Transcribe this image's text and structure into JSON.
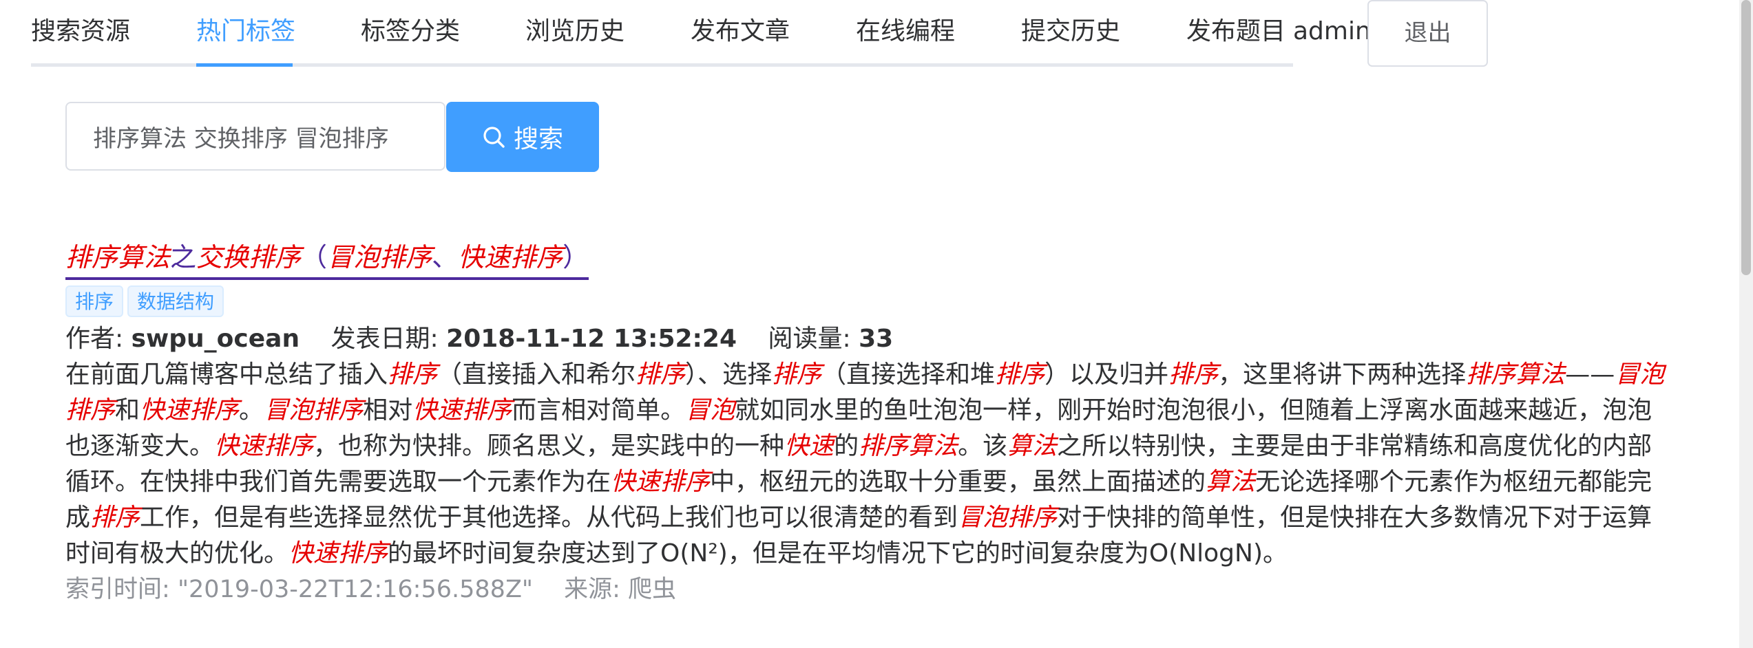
{
  "nav": {
    "tabs": [
      "搜索资源",
      "热门标签",
      "标签分类",
      "浏览历史",
      "发布文章",
      "在线编程",
      "提交历史",
      "发布题目"
    ],
    "active_tab": "热门标签",
    "user": "admin",
    "logout_label": "退出"
  },
  "search": {
    "value": "排序算法 交换排序 冒泡排序",
    "button_label": "搜索",
    "button_icon": "search-icon"
  },
  "result": {
    "title_segments": [
      {
        "text": "排序算法",
        "highlight": true
      },
      {
        "text": "之",
        "highlight": false
      },
      {
        "text": "交换排序",
        "highlight": true
      },
      {
        "text": "（",
        "highlight": false
      },
      {
        "text": "冒泡排序",
        "highlight": true
      },
      {
        "text": "、",
        "highlight": false
      },
      {
        "text": "快速排序",
        "highlight": true
      },
      {
        "text": "）",
        "highlight": false
      }
    ],
    "tags": [
      "排序",
      "数据结构"
    ],
    "author_label": "作者:",
    "author": "swpu_ocean",
    "date_label": "发表日期:",
    "date": "2018-11-12 13:52:24",
    "reads_label": "阅读量:",
    "reads": "33",
    "summary_segments": [
      {
        "text": "在前面几篇博客中总结了插入",
        "highlight": false
      },
      {
        "text": "排序",
        "highlight": true
      },
      {
        "text": "（直接插入和希尔",
        "highlight": false
      },
      {
        "text": "排序",
        "highlight": true
      },
      {
        "text": "）、选择",
        "highlight": false
      },
      {
        "text": "排序",
        "highlight": true
      },
      {
        "text": "（直接选择和堆",
        "highlight": false
      },
      {
        "text": "排序",
        "highlight": true
      },
      {
        "text": "）以及归并",
        "highlight": false
      },
      {
        "text": "排序",
        "highlight": true
      },
      {
        "text": "，这里将讲下两种选择",
        "highlight": false
      },
      {
        "text": "排序算法",
        "highlight": true
      },
      {
        "text": "——",
        "highlight": false
      },
      {
        "text": "冒泡排序",
        "highlight": true
      },
      {
        "text": "和",
        "highlight": false
      },
      {
        "text": "快速排序",
        "highlight": true
      },
      {
        "text": "。",
        "highlight": false
      },
      {
        "text": "冒泡排序",
        "highlight": true
      },
      {
        "text": "相对",
        "highlight": false
      },
      {
        "text": "快速排序",
        "highlight": true
      },
      {
        "text": "而言相对简单。",
        "highlight": false
      },
      {
        "text": "冒泡",
        "highlight": true
      },
      {
        "text": "就如同水里的鱼吐泡泡一样，刚开始时泡泡很小，但随着上浮离水面越来越近，泡泡也逐渐变大。",
        "highlight": false
      },
      {
        "text": "快速排序",
        "highlight": true
      },
      {
        "text": "，也称为快排。顾名思义，是实践中的一种",
        "highlight": false
      },
      {
        "text": "快速",
        "highlight": true
      },
      {
        "text": "的",
        "highlight": false
      },
      {
        "text": "排序算法",
        "highlight": true
      },
      {
        "text": "。该",
        "highlight": false
      },
      {
        "text": "算法",
        "highlight": true
      },
      {
        "text": "之所以特别快，主要是由于非常精练和高度优化的内部循环。在快排中我们首先需要选取一个元素作为在",
        "highlight": false
      },
      {
        "text": "快速排序",
        "highlight": true
      },
      {
        "text": "中，枢纽元的选取十分重要，虽然上面描述的",
        "highlight": false
      },
      {
        "text": "算法",
        "highlight": true
      },
      {
        "text": "无论选择哪个元素作为枢纽元都能完成",
        "highlight": false
      },
      {
        "text": "排序",
        "highlight": true
      },
      {
        "text": "工作，但是有些选择显然优于其他选择。从代码上我们也可以很清楚的看到",
        "highlight": false
      },
      {
        "text": "冒泡排序",
        "highlight": true
      },
      {
        "text": "对于快排的简单性，但是快排在大多数情况下对于运算时间有极大的优化。",
        "highlight": false
      },
      {
        "text": "快速排序",
        "highlight": true
      },
      {
        "text": "的最坏时间复杂度达到了O(N²)，但是在平均情况下它的时间复杂度为O(NlogN)。",
        "highlight": false
      }
    ],
    "index_time_label": "索引时间:",
    "index_time": "\"2019-03-22T12:16:56.588Z\"",
    "source_label": "来源:",
    "source": "爬虫"
  },
  "colors": {
    "accent": "#409eff",
    "highlight": "#e60000",
    "title_link": "#4d2a9d",
    "muted": "#909399"
  }
}
